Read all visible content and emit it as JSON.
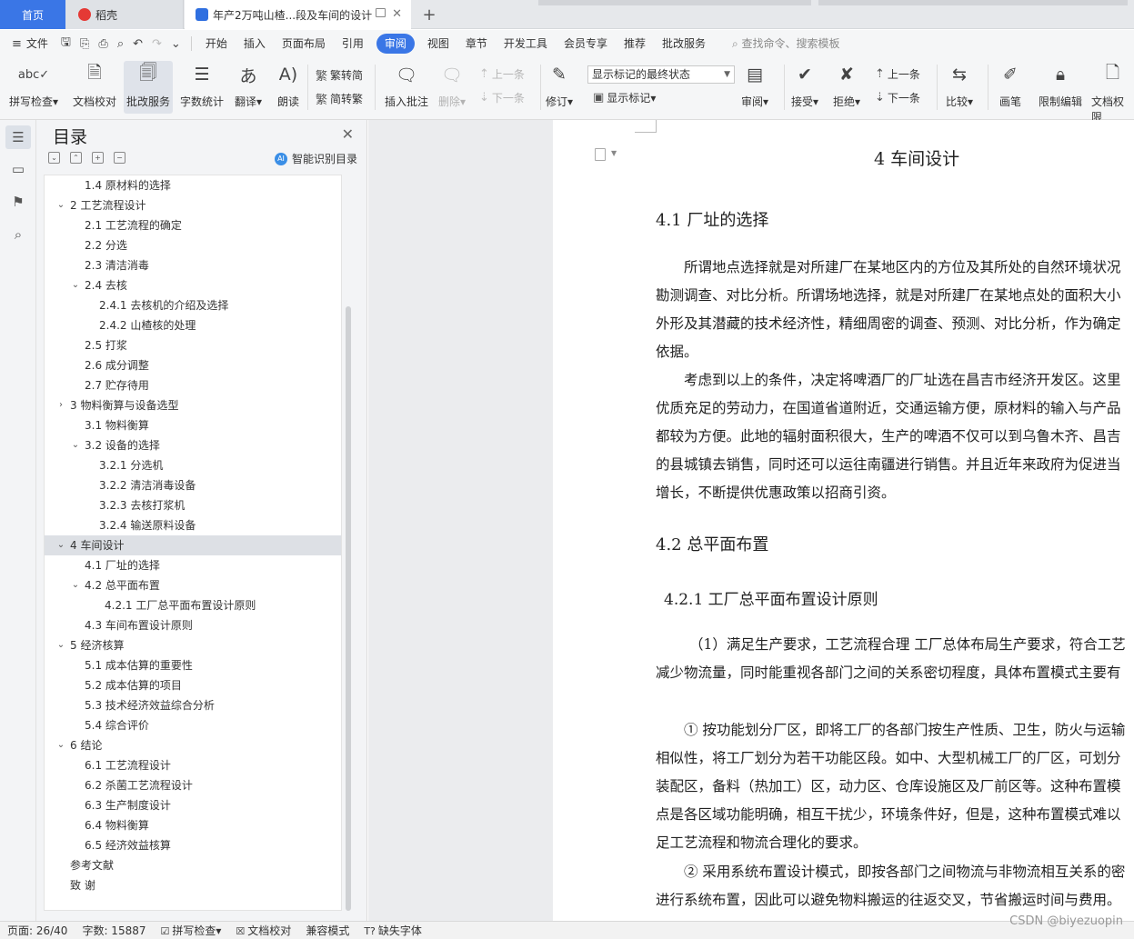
{
  "tabs": {
    "home": "首页",
    "daoke": "稻壳",
    "doc": "年产2万吨山楂...段及车间的设计"
  },
  "menu": {
    "file": "文件",
    "items": [
      "开始",
      "插入",
      "页面布局",
      "引用",
      "审阅",
      "视图",
      "章节",
      "开发工具",
      "会员专享",
      "推荐",
      "批改服务"
    ],
    "active": "审阅",
    "search": "查找命令、搜索模板"
  },
  "ribbon": {
    "spell": "拼写检查",
    "proof": "文档校对",
    "correction": "批改服务",
    "wordcount": "字数统计",
    "translate": "翻译",
    "read": "朗读",
    "to_trad": "繁转简",
    "to_simp": "简转繁",
    "insert_comment": "插入批注",
    "delete": "删除",
    "prev": "上一条",
    "next": "下一条",
    "revise": "修订",
    "markup_state": "显示标记的最终状态",
    "show_markup": "显示标记",
    "review": "审阅",
    "accept": "接受",
    "reject": "拒绝",
    "prev2": "上一条",
    "next2": "下一条",
    "compare": "比较",
    "pen": "画笔",
    "restrict": "限制编辑",
    "doc_rights": "文档权限"
  },
  "toc": {
    "title": "目录",
    "smart": "智能识别目录",
    "items": [
      {
        "text": "1.4 原材料的选择",
        "level": 2,
        "arrow": ""
      },
      {
        "text": "2 工艺流程设计",
        "level": 1,
        "arrow": "v"
      },
      {
        "text": "2.1 工艺流程的确定",
        "level": 2,
        "arrow": ""
      },
      {
        "text": "2.2 分选",
        "level": 2,
        "arrow": ""
      },
      {
        "text": "2.3 清洁消毒",
        "level": 2,
        "arrow": ""
      },
      {
        "text": "2.4 去核",
        "level": 2,
        "arrow": "v"
      },
      {
        "text": "2.4.1 去核机的介绍及选择",
        "level": 3,
        "arrow": ""
      },
      {
        "text": "2.4.2 山楂核的处理",
        "level": 3,
        "arrow": ""
      },
      {
        "text": "2.5 打浆",
        "level": 2,
        "arrow": ""
      },
      {
        "text": "2.6 成分调整",
        "level": 2,
        "arrow": ""
      },
      {
        "text": "2.7 贮存待用",
        "level": 2,
        "arrow": ""
      },
      {
        "text": "3  物料衡算与设备选型",
        "level": 1,
        "arrow": ">"
      },
      {
        "text": "3.1 物料衡算",
        "level": 2,
        "arrow": ""
      },
      {
        "text": "3.2 设备的选择",
        "level": 2,
        "arrow": "v"
      },
      {
        "text": "3.2.1 分选机",
        "level": 3,
        "arrow": ""
      },
      {
        "text": "3.2.2 清洁消毒设备",
        "level": 3,
        "arrow": ""
      },
      {
        "text": "3.2.3 去核打浆机",
        "level": 3,
        "arrow": ""
      },
      {
        "text": "3.2.4 输送原料设备",
        "level": 3,
        "arrow": ""
      },
      {
        "text": "4 车间设计",
        "level": 1,
        "arrow": "v",
        "selected": true
      },
      {
        "text": "4.1  厂址的选择",
        "level": 2,
        "arrow": ""
      },
      {
        "text": "4.2  总平面布置",
        "level": 2,
        "arrow": "v"
      },
      {
        "text": "4.2.1 工厂总平面布置设计原则",
        "level": 4,
        "arrow": ""
      },
      {
        "text": "4.3  车间布置设计原则",
        "level": 2,
        "arrow": ""
      },
      {
        "text": "5 经济核算",
        "level": 1,
        "arrow": "v"
      },
      {
        "text": "5.1 成本估算的重要性",
        "level": 2,
        "arrow": ""
      },
      {
        "text": "5.2 成本估算的项目",
        "level": 2,
        "arrow": ""
      },
      {
        "text": "5.3 技术经济效益综合分析",
        "level": 2,
        "arrow": ""
      },
      {
        "text": "5.4 综合评价",
        "level": 2,
        "arrow": ""
      },
      {
        "text": "6 结论",
        "level": 1,
        "arrow": "v"
      },
      {
        "text": "6.1 工艺流程设计",
        "level": 2,
        "arrow": ""
      },
      {
        "text": "6.2 杀菌工艺流程设计",
        "level": 2,
        "arrow": ""
      },
      {
        "text": "6.3 生产制度设计",
        "level": 2,
        "arrow": ""
      },
      {
        "text": "6.4 物料衡算",
        "level": 2,
        "arrow": ""
      },
      {
        "text": "6.5 经济效益核算",
        "level": 2,
        "arrow": ""
      },
      {
        "text": "参考文献",
        "level": 1,
        "arrow": ""
      },
      {
        "text": "致   谢",
        "level": 1,
        "arrow": ""
      }
    ]
  },
  "document": {
    "chapter": "4 车间设计",
    "s41": "4.1  厂址的选择",
    "p1": [
      "所谓地点选择就是对所建厂在某地区内的方位及其所处的自然环境状况",
      "勘测调查、对比分析。所谓场地选择，就是对所建厂在某地点处的面积大小",
      "外形及其潜藏的技术经济性，精细周密的调查、预测、对比分析，作为确定",
      "依据。"
    ],
    "p2": [
      "考虑到以上的条件，决定将啤酒厂的厂址选在昌吉市经济开发区。这里",
      "优质充足的劳动力，在国道省道附近，交通运输方便，原材料的输入与产品",
      "都较为方便。此地的辐射面积很大，生产的啤酒不仅可以到乌鲁木齐、昌吉",
      "的县城镇去销售，同时还可以运往南疆进行销售。并且近年来政府为促进当",
      "增长，不断提供优惠政策以招商引资。"
    ],
    "s42": "4.2  总平面布置",
    "s421": "4.2.1 工厂总平面布置设计原则",
    "p3": [
      "（1）满足生产要求，工艺流程合理   工厂总体布局生产要求，符合工艺",
      "减少物流量，同时能重视各部门之间的关系密切程度，具体布置模式主要有"
    ],
    "p4": [
      "①  按功能划分厂区，即将工厂的各部门按生产性质、卫生，防火与运输",
      "相似性，将工厂划分为若干功能区段。如中、大型机械工厂的厂区，可划分",
      "装配区，备料（热加工）区，动力区、仓库设施区及厂前区等。这种布置模",
      "点是各区域功能明确，相互干扰少，环境条件好，但是，这种布置模式难以",
      "足工艺流程和物流合理化的要求。"
    ],
    "p5": [
      "②  采用系统布置设计模式，即按各部门之间物流与非物流相互关系的密",
      "进行系统布置，因此可以避免物料搬运的往返交叉，节省搬运时间与费用。"
    ]
  },
  "status": {
    "page": "页面: 26/40",
    "words": "字数: 15887",
    "spell": "拼写检查",
    "proof": "文档校对",
    "compat": "兼容模式",
    "missing_font": "缺失字体"
  },
  "watermark": "CSDN @biyezuopin"
}
